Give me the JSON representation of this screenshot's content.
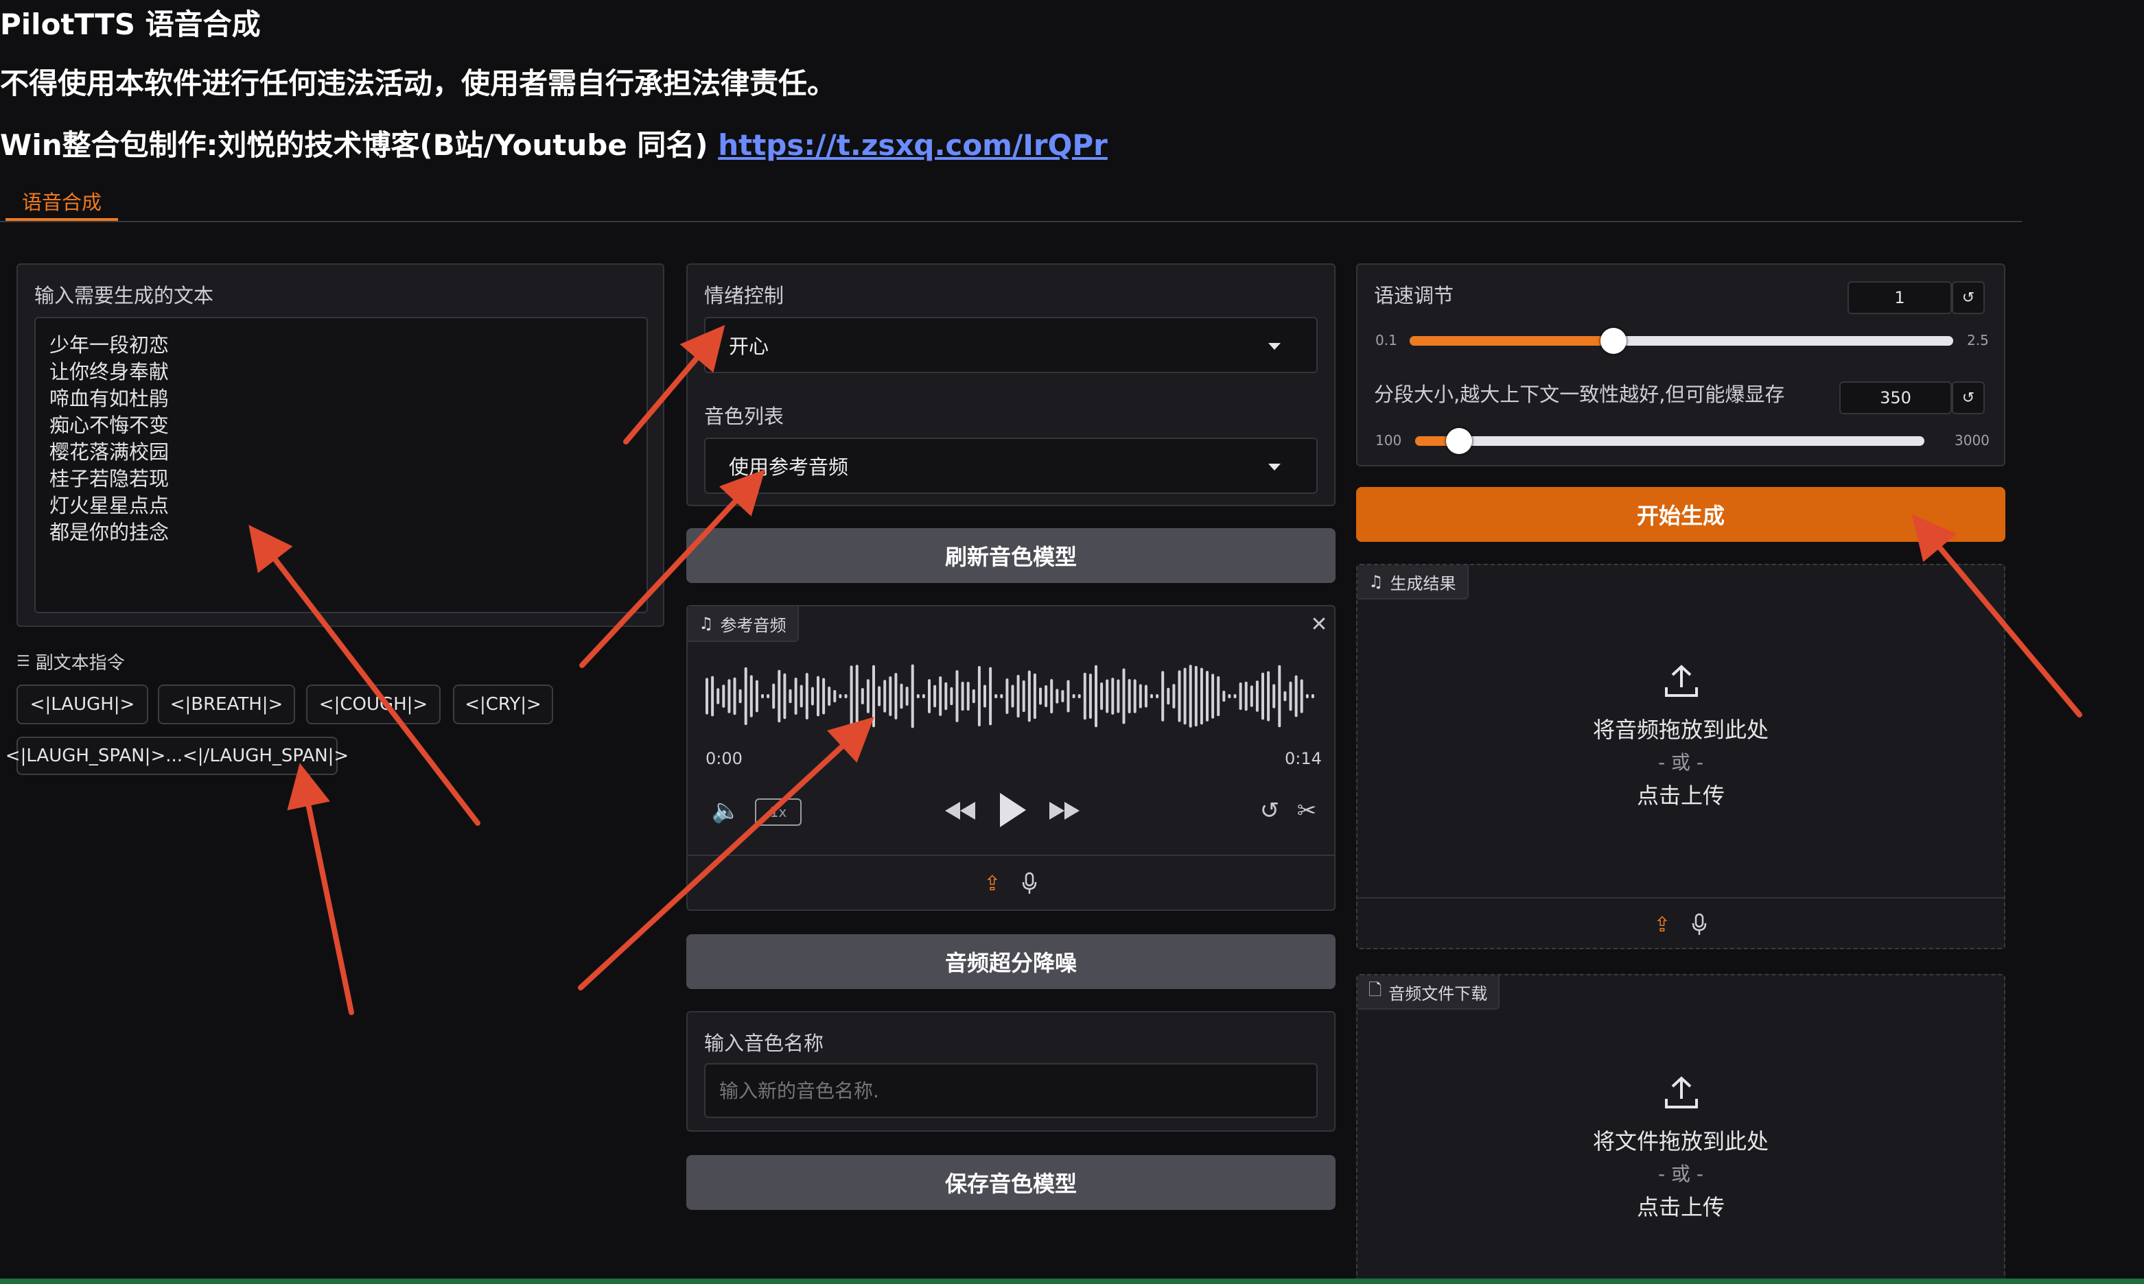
{
  "header": {
    "title": "PilotTTS 语音合成",
    "warning": "不得使用本软件进行任何违法活动，使用者需自行承担法律责任。",
    "credit": "Win整合包制作:刘悦的技术博客(B站/Youtube 同名) ",
    "credit_link": "https://t.zsxq.com/IrQPr"
  },
  "tabs": [
    {
      "label": "语音合成",
      "active": true
    }
  ],
  "text_input": {
    "label": "输入需要生成的文本",
    "value": "少年一段初恋\n让你终身奉献\n啼血有如杜鹃\n痴心不悔不变\n樱花落满校园\n桂子若隐若现\n灯火星星点点\n都是你的挂念"
  },
  "sub_text": {
    "label": "副文本指令",
    "chips": [
      "<|LAUGH|>",
      "<|BREATH|>",
      "<|COUGH|>",
      "<|CRY|>",
      "<|LAUGH_SPAN|>...<|/LAUGH_SPAN|>"
    ]
  },
  "emotion": {
    "label": "情绪控制",
    "value": "开心"
  },
  "voice_list": {
    "label": "音色列表",
    "value": "使用参考音频"
  },
  "refresh_button": "刷新音色模型",
  "ref_audio": {
    "label": "参考音频",
    "time_start": "0:00",
    "time_end": "0:14",
    "speed": "1x"
  },
  "denoise_button": "音频超分降噪",
  "voice_name": {
    "label": "输入音色名称",
    "placeholder": "输入新的音色名称."
  },
  "save_button": "保存音色模型",
  "speed": {
    "label": "语速调节",
    "value": "1",
    "min": "0.1",
    "max": "2.5",
    "level": 0.375
  },
  "segment": {
    "label": "分段大小,越大上下文一致性越好,但可能爆显存",
    "value": "350",
    "min": "100",
    "max": "3000",
    "level": 0.086
  },
  "generate_button": "开始生成",
  "result": {
    "label": "生成结果",
    "drop_text": "将音频拖放到此处",
    "or_text": "- 或 -",
    "click_text": "点击上传"
  },
  "download": {
    "label": "音频文件下载",
    "drop_text": "将文件拖放到此处",
    "or_text": "- 或 -",
    "click_text": "点击上传"
  },
  "colors": {
    "accent": "#d9660c",
    "tab_active": "#ee7a21",
    "annotation_arrow": "#e04a2f",
    "link": "#6b8cff"
  }
}
